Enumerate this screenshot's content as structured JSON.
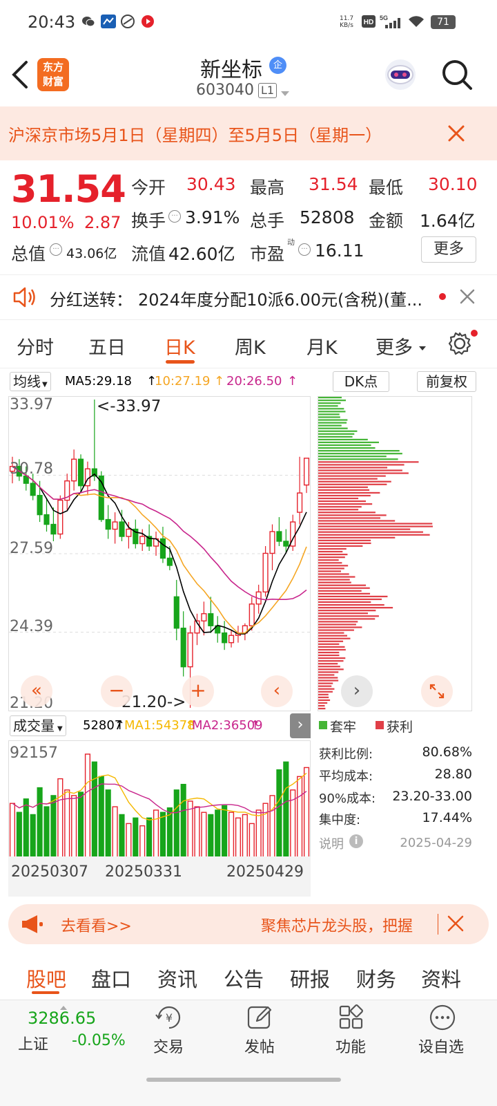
{
  "status": {
    "time": "20:43",
    "net_speed_top": "11.7",
    "net_speed_bottom": "KB/s",
    "battery": "71"
  },
  "header": {
    "stock_name": "新坐标",
    "badge": "企",
    "stock_code": "603040",
    "level": "L1",
    "logo_line1": "东方",
    "logo_line2": "财富"
  },
  "notice": {
    "text": "沪深京市场5月1日（星期四）至5月5日（星期一）"
  },
  "quote": {
    "price": "31.54",
    "change_pct": "10.01%",
    "change": "2.87",
    "open_label": "今开",
    "open": "30.43",
    "high_label": "最高",
    "high": "31.54",
    "low_label": "最低",
    "low": "30.10",
    "turnover_label": "换手",
    "turnover": "3.91%",
    "volume_label": "总手",
    "volume": "52808",
    "amount_label": "金额",
    "amount": "1.64亿",
    "mktcap_label": "总值",
    "mktcap": "43.06亿",
    "float_label": "流值",
    "float": "42.60亿",
    "pe_label": "市盈",
    "pe_sup": "动",
    "pe": "16.11",
    "more_button": "更多"
  },
  "dividend": {
    "label": "分红送转：",
    "text": "2024年度分配10派6.00元(含税)(董..."
  },
  "tabs": [
    "分时",
    "五日",
    "日K",
    "周K",
    "月K",
    "更多"
  ],
  "active_tab": "日K",
  "chart_toolbar": {
    "ma_select": "均线",
    "ma5": "MA5:29.18",
    "ma10": "10:27.19",
    "ma20": "20:26.50",
    "dk_button": "DK点",
    "adjust_button": "前复权"
  },
  "chart_labels": {
    "y_top": "33.97",
    "y_2": "30.78",
    "y_3": "27.59",
    "y_4": "24.39",
    "y_bottom": "21.20",
    "max_annotation": "<-33.97",
    "min_annotation": "21.20->"
  },
  "volume_toolbar": {
    "select": "成交量",
    "vol": "52807",
    "ma1": "MA1:54378",
    "ma2": "MA2:36509",
    "y_top": "92157"
  },
  "dates": [
    "20250307",
    "20250331",
    "20250429"
  ],
  "chip": {
    "legend_trapped": "套牢",
    "legend_profit": "获利",
    "profit_ratio_label": "获利比例:",
    "profit_ratio": "80.68%",
    "avg_cost_label": "平均成本:",
    "avg_cost": "28.80",
    "cost90_label": "90%成本:",
    "cost90": "23.20-33.00",
    "concentration_label": "集中度:",
    "concentration": "17.44%",
    "explain_label": "说明",
    "date": "2025-04-29"
  },
  "ad": {
    "go_see": "去看看>>",
    "text": "聚焦芯片龙头股，把握"
  },
  "bottom_tabs": [
    "股吧",
    "盘口",
    "资讯",
    "公告",
    "研报",
    "财务",
    "资料"
  ],
  "index": {
    "value": "3286.65",
    "name": "上证",
    "change": "-0.05%"
  },
  "nav": [
    "交易",
    "发帖",
    "功能",
    "设自选"
  ],
  "colors": {
    "accent": "#e8541a",
    "up": "#e5212b",
    "down": "#17a51b",
    "ma5": "#000000",
    "ma10": "#f5a623",
    "ma20": "#c8258c"
  },
  "chart_data": {
    "type": "candlestick",
    "title": "",
    "ylim": [
      21.2,
      33.97
    ],
    "ohlc": [
      [
        31.0,
        31.6,
        30.5,
        31.2
      ],
      [
        31.2,
        31.5,
        30.6,
        30.8
      ],
      [
        30.8,
        31.2,
        30.2,
        30.5
      ],
      [
        30.5,
        30.9,
        29.8,
        30.0
      ],
      [
        30.0,
        30.6,
        28.9,
        29.2
      ],
      [
        29.2,
        29.9,
        28.5,
        28.8
      ],
      [
        28.8,
        29.5,
        28.1,
        28.4
      ],
      [
        28.4,
        30.0,
        28.2,
        29.8
      ],
      [
        29.8,
        30.9,
        29.4,
        30.6
      ],
      [
        30.6,
        31.9,
        30.2,
        31.5
      ],
      [
        31.5,
        31.7,
        30.1,
        30.4
      ],
      [
        30.4,
        31.4,
        30.0,
        31.1
      ],
      [
        31.1,
        33.97,
        30.6,
        30.8
      ],
      [
        30.8,
        31.0,
        28.9,
        29.0
      ],
      [
        29.0,
        29.6,
        28.2,
        28.6
      ],
      [
        28.6,
        29.3,
        28.0,
        28.9
      ],
      [
        28.9,
        29.4,
        28.1,
        28.3
      ],
      [
        28.3,
        28.9,
        27.8,
        28.6
      ],
      [
        28.6,
        29.0,
        27.8,
        28.0
      ],
      [
        28.0,
        28.6,
        27.7,
        28.3
      ],
      [
        28.3,
        28.8,
        27.7,
        27.9
      ],
      [
        27.9,
        28.5,
        27.5,
        28.2
      ],
      [
        28.2,
        28.7,
        27.2,
        27.4
      ],
      [
        27.4,
        27.9,
        26.9,
        27.1
      ],
      [
        25.8,
        26.5,
        24.0,
        24.5
      ],
      [
        24.5,
        25.2,
        22.5,
        22.9
      ],
      [
        22.9,
        24.6,
        21.2,
        24.3
      ],
      [
        24.3,
        25.1,
        23.8,
        24.8
      ],
      [
        24.8,
        25.6,
        24.2,
        25.1
      ],
      [
        25.1,
        25.8,
        24.3,
        24.6
      ],
      [
        24.6,
        25.0,
        23.9,
        24.3
      ],
      [
        24.3,
        24.8,
        23.6,
        23.9
      ],
      [
        23.9,
        24.4,
        23.7,
        24.2
      ],
      [
        24.2,
        24.6,
        23.9,
        24.3
      ],
      [
        24.3,
        24.7,
        24.0,
        24.6
      ],
      [
        24.6,
        25.8,
        24.4,
        25.5
      ],
      [
        25.5,
        26.3,
        25.1,
        26.0
      ],
      [
        26.0,
        27.9,
        25.8,
        27.6
      ],
      [
        27.6,
        28.8,
        26.9,
        28.5
      ],
      [
        28.5,
        29.1,
        27.9,
        28.1
      ],
      [
        28.1,
        28.6,
        27.6,
        27.9
      ],
      [
        27.9,
        29.2,
        27.7,
        28.9
      ],
      [
        29.3,
        31.6,
        28.8,
        30.1
      ],
      [
        30.43,
        31.54,
        30.1,
        31.54
      ]
    ],
    "volume": [
      48,
      40,
      52,
      38,
      62,
      45,
      55,
      70,
      60,
      55,
      58,
      92,
      85,
      72,
      60,
      45,
      38,
      30,
      35,
      28,
      35,
      42,
      40,
      44,
      60,
      65,
      50,
      45,
      40,
      38,
      42,
      46,
      40,
      35,
      38,
      30,
      42,
      48,
      55,
      78,
      85,
      60,
      72,
      80
    ],
    "volume_ylim": [
      0,
      92157
    ]
  }
}
